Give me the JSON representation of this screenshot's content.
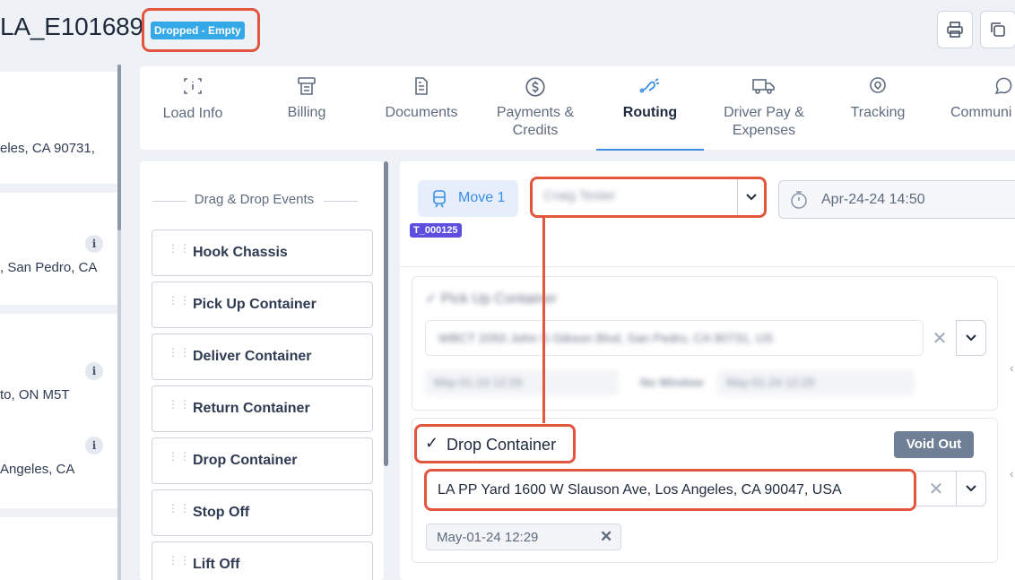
{
  "header": {
    "load_id": "LA_E101689",
    "status_badge": "Dropped - Empty",
    "print_icon": "printer-icon",
    "copy_icon": "copy-icon"
  },
  "left_panel": {
    "cards": [
      {
        "text": "eles, CA 90731,"
      },
      {
        "text": ", San Pedro, CA"
      },
      {
        "text": "to, ON M5T"
      },
      {
        "text": "Angeles, CA"
      }
    ],
    "info_label": "i"
  },
  "tabs": [
    {
      "label": "Load Info",
      "icon": "load-info-icon"
    },
    {
      "label": "Billing",
      "icon": "billing-icon"
    },
    {
      "label": "Documents",
      "icon": "documents-icon"
    },
    {
      "label": "Payments &",
      "label2": "Credits",
      "icon": "payments-icon"
    },
    {
      "label": "Routing",
      "icon": "routing-icon",
      "active": true
    },
    {
      "label": "Driver Pay &",
      "label2": "Expenses",
      "icon": "driver-pay-icon"
    },
    {
      "label": "Tracking",
      "icon": "tracking-icon"
    },
    {
      "label": "Communi",
      "icon": "communication-icon"
    }
  ],
  "events": {
    "title": "Drag & Drop Events",
    "items": [
      "Hook Chassis",
      "Pick Up Container",
      "Deliver Container",
      "Return Container",
      "Drop Container",
      "Stop Off",
      "Lift Off"
    ]
  },
  "routing": {
    "move_label": "Move 1",
    "trip_badge": "T_000125",
    "driver_value": "Craig Tester",
    "date_value": "Apr-24-24 14:50",
    "pickup": {
      "title": "Pick Up Container",
      "address": "WBCT 2050 John S Gibson Blvd, San Pedro, CA 90731, US",
      "date_from": "May-01-24 12:29",
      "window": "No Window",
      "date_to": "May-01-24 12:29"
    },
    "drop": {
      "check": "✓",
      "title": "Drop Container",
      "void_label": "Void Out",
      "address": "LA PP Yard 1600 W Slauson Ave, Los Angeles, CA 90047, USA",
      "date": "May-01-24 12:29",
      "clear": "✕"
    }
  },
  "colors": {
    "accent": "#3a8ee6",
    "highlight": "#e2563f",
    "badge": "#35a8e8",
    "trip_badge": "#5d4ee0",
    "void": "#6e7f96"
  }
}
